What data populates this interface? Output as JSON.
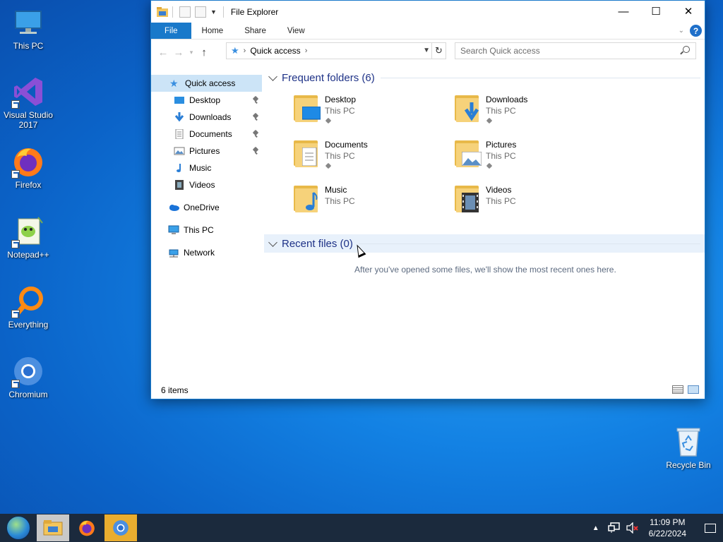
{
  "desktop": {
    "icons": [
      {
        "label": "This PC"
      },
      {
        "label": "Visual Studio 2017"
      },
      {
        "label": "Firefox"
      },
      {
        "label": "Notepad++"
      },
      {
        "label": "Everything"
      },
      {
        "label": "Chromium"
      },
      {
        "label": "Recycle Bin"
      }
    ]
  },
  "window": {
    "title": "File Explorer",
    "controls": {
      "minimize": "—",
      "maximize": "☐",
      "close": "✕"
    },
    "ribbon": {
      "tabs": [
        "File",
        "Home",
        "Share",
        "View"
      ],
      "help": "?"
    },
    "nav": {
      "back": "←",
      "forward": "→",
      "up": "↑",
      "address": "Quick access",
      "search_placeholder": "Search Quick access"
    },
    "sidebar": {
      "items": [
        {
          "label": "Quick access"
        },
        {
          "label": "Desktop"
        },
        {
          "label": "Downloads"
        },
        {
          "label": "Documents"
        },
        {
          "label": "Pictures"
        },
        {
          "label": "Music"
        },
        {
          "label": "Videos"
        },
        {
          "label": "OneDrive"
        },
        {
          "label": "This PC"
        },
        {
          "label": "Network"
        }
      ]
    },
    "frequent": {
      "header": "Frequent folders (6)",
      "folders": [
        {
          "name": "Desktop",
          "location": "This PC"
        },
        {
          "name": "Downloads",
          "location": "This PC"
        },
        {
          "name": "Documents",
          "location": "This PC"
        },
        {
          "name": "Pictures",
          "location": "This PC"
        },
        {
          "name": "Music",
          "location": "This PC"
        },
        {
          "name": "Videos",
          "location": "This PC"
        }
      ]
    },
    "recent": {
      "header": "Recent files (0)",
      "empty_message": "After you've opened some files, we'll show the most recent ones here."
    },
    "status": {
      "count": "6 items"
    }
  },
  "taskbar": {
    "clock_time": "11:09 PM",
    "clock_date": "6/22/2024"
  },
  "colors": {
    "accent": "#1979ca",
    "header_text": "#1e3287"
  }
}
